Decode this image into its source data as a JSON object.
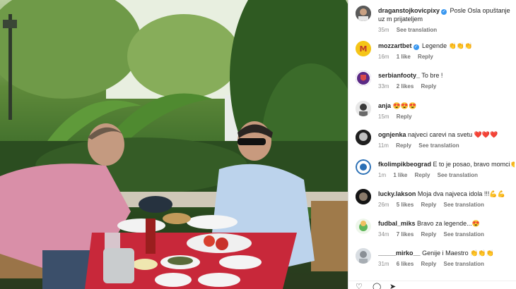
{
  "post": {
    "author": "draganstojkovicpixy",
    "caption": "Posle Osla opuštanje uz m prijateljem",
    "time": "35m",
    "see_translation": "See translation"
  },
  "comments": [
    {
      "user": "mozzartbet",
      "verified": true,
      "text": "Legende 👏👏👏",
      "time": "16m",
      "likes": "1 like",
      "reply": "Reply",
      "translation": ""
    },
    {
      "user": "serbianfooty_",
      "verified": false,
      "text": "To bre !",
      "time": "33m",
      "likes": "2 likes",
      "reply": "Reply",
      "translation": ""
    },
    {
      "user": "anja",
      "verified": false,
      "text": "😍😍😍",
      "time": "15m",
      "likes": "",
      "reply": "Reply",
      "translation": ""
    },
    {
      "user": "ognjenka",
      "verified": false,
      "text": "najveci carevi na svetu ❤️❤️❤️",
      "time": "11m",
      "likes": "",
      "reply": "Reply",
      "translation": "See translation"
    },
    {
      "user": "fkolimpikbeograd",
      "verified": false,
      "text": "E to je posao, bravo momci👏👏",
      "time": "1m",
      "likes": "1 like",
      "reply": "Reply",
      "translation": "See translation"
    },
    {
      "user": "lucky.lakson",
      "verified": false,
      "text": "Moja dva najveca idola !!!💪💪",
      "time": "26m",
      "likes": "5 likes",
      "reply": "Reply",
      "translation": "See translation"
    },
    {
      "user": "fudbal_miks",
      "verified": false,
      "text": "Bravo za legende...😍",
      "time": "34m",
      "likes": "7 likes",
      "reply": "Reply",
      "translation": "See translation"
    },
    {
      "user": "_____mirko__",
      "verified": false,
      "text": "Genije i Maestro 👏👏👏",
      "time": "31m",
      "likes": "6 likes",
      "reply": "Reply",
      "translation": "See translation"
    }
  ],
  "colors": {
    "tablecloth": "#c8283a",
    "shirt_left": "#d98fa8",
    "shirt_right": "#bcd3ec",
    "verified": "#3897f0"
  }
}
